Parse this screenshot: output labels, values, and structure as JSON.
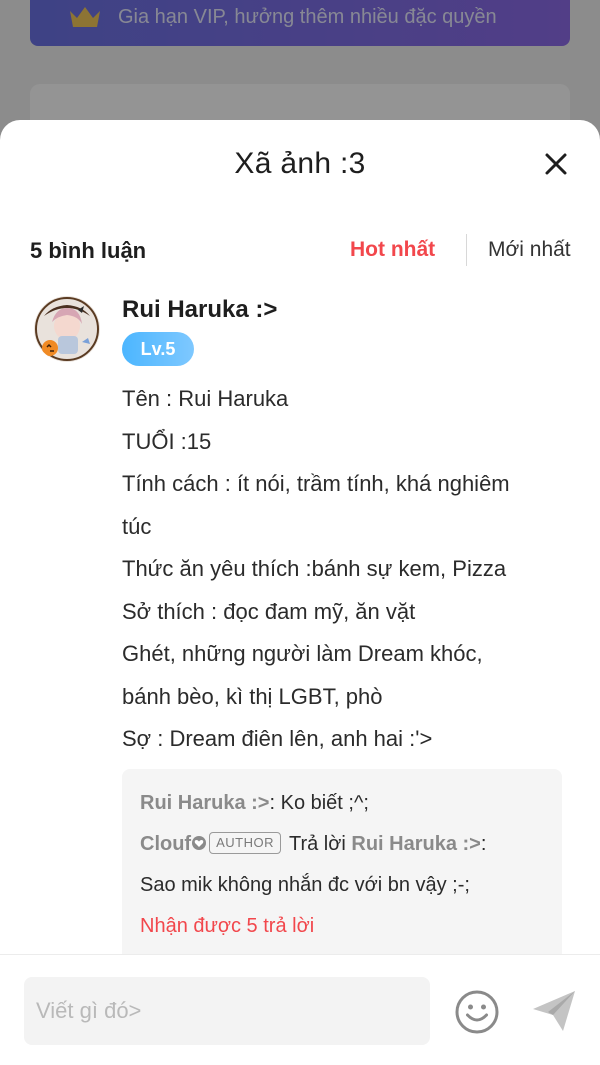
{
  "background": {
    "vip_banner_text": "Gia hạn VIP, hưởng thêm nhiều đặc quyền"
  },
  "sheet": {
    "title": "Xã ảnh :3",
    "comments_count": "5 bình luận",
    "sort_hot": "Hot nhất",
    "sort_new": "Mới nhất"
  },
  "comment": {
    "author": "Rui Haruka :>",
    "level": "Lv.5",
    "lines": [
      "Tên : Rui Haruka",
      "TUỔI :15",
      "Tính cách : ít nói, trầm tính, khá nghiêm",
      "túc",
      "Thức ăn yêu thích :bánh sự kem, Pizza",
      "Sở thích : đọc đam mỹ, ăn vặt",
      "Ghét, những người làm Dream khóc,",
      "bánh bèo, kì thị LGBT, phò",
      "Sợ : Dream điên lên, anh hai :'>"
    ],
    "replies": {
      "reply1_name": "Rui Haruka :>",
      "reply1_text": ": Ko biết ;^;",
      "reply2_name": "Clouf",
      "reply2_tag": "AUTHOR",
      "reply2_prefix": "Trả lời",
      "reply2_target": "Rui Haruka :>",
      "reply2_colon": ":",
      "reply2_text": "Sao mik không nhắn đc với bn vậy ;-;",
      "more_label": "Nhận được 5 trả lời"
    }
  },
  "input_bar": {
    "placeholder": "Viết gì đó>"
  },
  "colors": {
    "accent_red": "#f2474c",
    "level_blue": "#4cb6ff",
    "vip_purple": "#7a6fe8"
  },
  "icons": {
    "close": "close-icon",
    "emoji": "smiley-icon",
    "send": "paper-plane-icon",
    "crown": "crown-icon",
    "avatar": "user-avatar"
  }
}
